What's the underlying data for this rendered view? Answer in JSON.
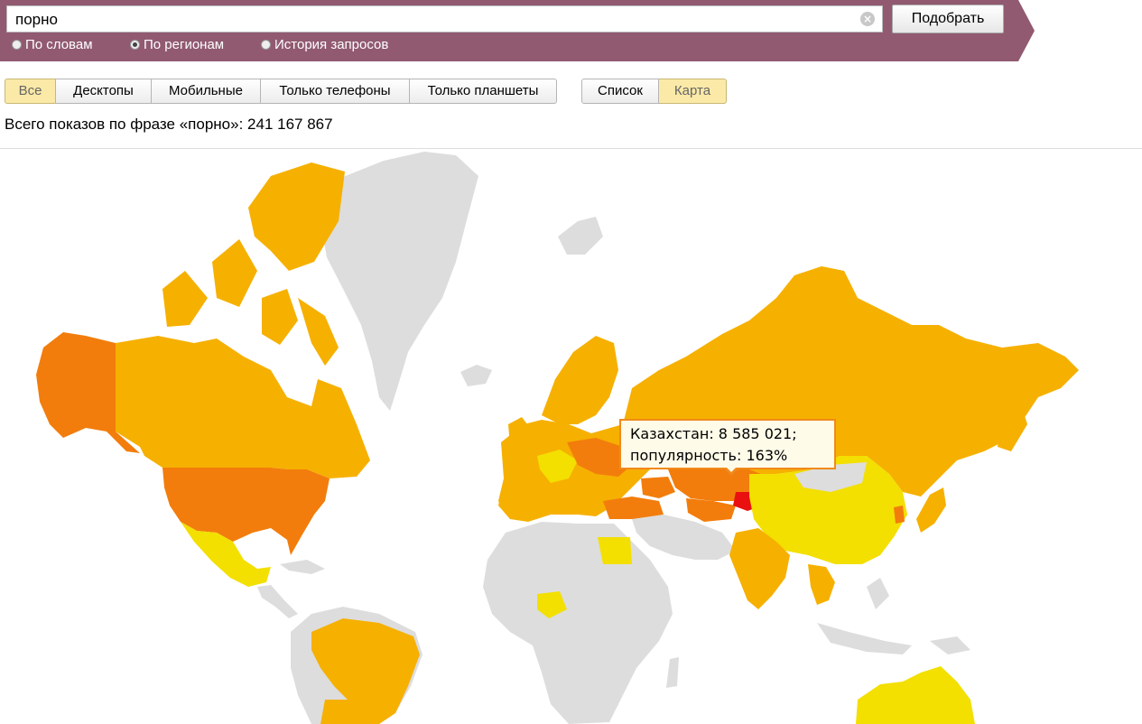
{
  "search": {
    "query": "порно",
    "clear_icon": "clear-icon",
    "submit_label": "Подобрать"
  },
  "modes": [
    {
      "label": "По словам",
      "checked": false
    },
    {
      "label": "По регионам",
      "checked": true
    },
    {
      "label": "История запросов",
      "checked": false
    }
  ],
  "device_filter": [
    "Все",
    "Десктопы",
    "Мобильные",
    "Только телефоны",
    "Только планшеты"
  ],
  "device_active": "Все",
  "view_toggle": [
    "Список",
    "Карта"
  ],
  "view_active": "Карта",
  "summary": "Всего показов по фразе «порно»: 241 167 867",
  "tooltip": {
    "line1": "Казахстан: 8 585 021;",
    "line2": "популярность: 163%"
  },
  "colors": {
    "banner": "#915a70",
    "no_data": "#dddddd",
    "high": "#f27d0c",
    "mid": "#f6b000",
    "low": "#f3df00",
    "peak": "#ea1010",
    "tooltip_border": "#f08a1a",
    "active_tab": "#fbe9a7"
  }
}
